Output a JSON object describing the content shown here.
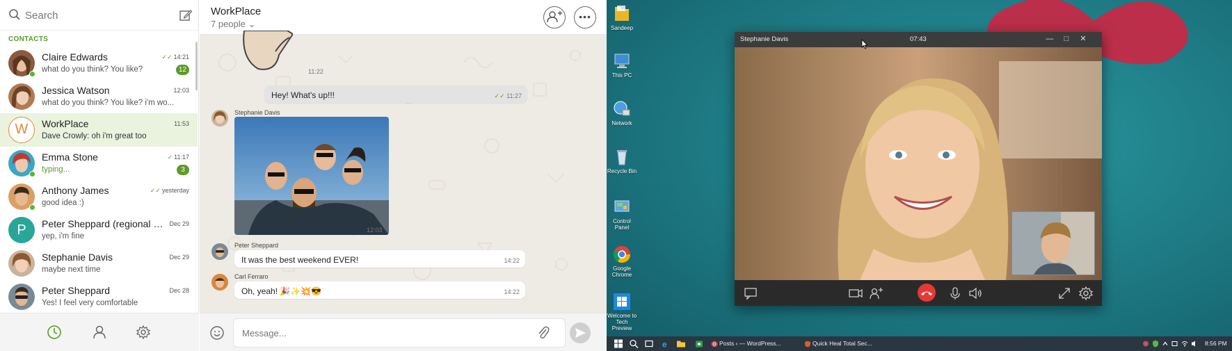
{
  "sidebar": {
    "search_placeholder": "Search",
    "heading": "CONTACTS",
    "contacts": [
      {
        "name": "Claire Edwards",
        "message": "what do you think? You like?",
        "time": "14:21",
        "ticks": "✓✓",
        "badge": "12",
        "online": true
      },
      {
        "name": "Jessica Watson",
        "message": "what do you think? You like? i'm wo...",
        "time": "12:03",
        "ticks": "",
        "badge": "",
        "online": false
      },
      {
        "name": "WorkPlace",
        "message": "Dave Crowly: oh i'm great too",
        "time": "11:53",
        "ticks": "",
        "badge": "",
        "online": false,
        "letter": "W"
      },
      {
        "name": "Emma Stone",
        "message": "typing...",
        "time": "11:17",
        "ticks": "✓",
        "badge": "3",
        "online": true
      },
      {
        "name": "Anthony James",
        "message": "good idea :)",
        "time": "yesterday",
        "ticks": "✓✓",
        "badge": "",
        "online": true
      },
      {
        "name": "Peter Sheppard (regional Of...)",
        "message": "yep, i'm fine",
        "time": "Dec 29",
        "ticks": "",
        "badge": "",
        "online": false,
        "letter": "P"
      },
      {
        "name": "Stephanie Davis",
        "message": "maybe next time",
        "time": "Dec 29",
        "ticks": "",
        "badge": "",
        "online": false
      },
      {
        "name": "Peter Sheppard",
        "message": "Yes! I feel very comfortable",
        "time": "Dec 28",
        "ticks": "",
        "badge": "",
        "online": false
      }
    ],
    "icons": [
      "search-icon",
      "compose-icon",
      "clock-icon",
      "person-icon",
      "gear-icon"
    ]
  },
  "chat": {
    "title": "WorkPlace",
    "subtitle": "7 people ⌄",
    "messages": {
      "sticker_time": "11:22",
      "out_text": "Hey! What's up!!!",
      "out_time": "11:27",
      "out_ticks": "✓✓",
      "photo_sender": "Stephanie Davis",
      "photo_time": "12:03",
      "m1_sender": "Peter Sheppard",
      "m1_text": "It was the best weekend EVER!",
      "m1_time": "14:22",
      "m2_sender": "Carl Ferraro",
      "m2_text": "Oh, yeah! 🎉✨💥😎",
      "m2_time": "14:22"
    },
    "composer_placeholder": "Message..."
  },
  "desktop": {
    "icons": [
      {
        "label": "Sandeep"
      },
      {
        "label": "This PC"
      },
      {
        "label": "Network"
      },
      {
        "label": "Recycle Bin"
      },
      {
        "label": "Control Panel"
      },
      {
        "label": "Google Chrome"
      },
      {
        "label": "Welcome to Tech Preview"
      }
    ],
    "call_window": {
      "name": "Stephanie Davis",
      "timer": "07:43"
    },
    "taskbar": {
      "task1": "Posts ‹ — WordPress...",
      "task2": "Quick Heal Total Sec...",
      "clock": "8:56 PM"
    }
  },
  "colors": {
    "accent": "#5b9a2a",
    "hangup": "#e53935",
    "desktop": "#1f7e88"
  }
}
